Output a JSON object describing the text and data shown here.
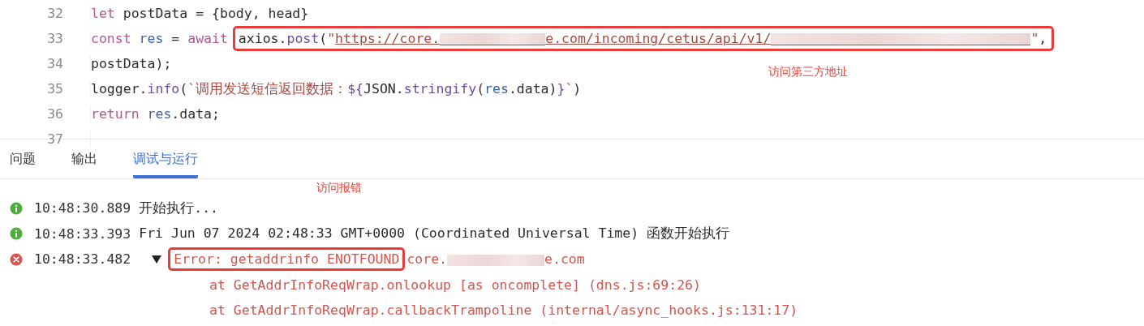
{
  "editor": {
    "lines": [
      {
        "number": "32",
        "tokens": [
          {
            "t": "let",
            "kind": "keyword"
          },
          {
            "t": " postData = {body, head}",
            "kind": "plain"
          }
        ]
      },
      {
        "number": "33",
        "tokens": [
          {
            "t": "const ",
            "kind": "keyword"
          },
          {
            "t": "res",
            "kind": "variable"
          },
          {
            "t": " = ",
            "kind": "plain"
          },
          {
            "t": "await ",
            "kind": "keyword"
          },
          {
            "kind": "box",
            "tokens": [
              {
                "t": "axios.",
                "kind": "plain"
              },
              {
                "t": "post",
                "kind": "method"
              },
              {
                "t": "(",
                "kind": "plain"
              },
              {
                "t": "\"",
                "kind": "string"
              },
              {
                "t": "https://core.",
                "kind": "link"
              },
              {
                "kind": "redacted-link"
              },
              {
                "t": "e.com/incoming/cetus/api/v1/",
                "kind": "link"
              },
              {
                "kind": "redacted-link"
              },
              {
                "t": "\"",
                "kind": "string"
              },
              {
                "t": ",",
                "kind": "plain"
              }
            ]
          }
        ]
      },
      {
        "number": "34",
        "tokens": [
          {
            "t": "postData);",
            "kind": "plain"
          }
        ]
      },
      {
        "number": "35",
        "tokens": [
          {
            "t": "logger.",
            "kind": "plain"
          },
          {
            "t": "info",
            "kind": "method"
          },
          {
            "t": "(",
            "kind": "plain"
          },
          {
            "t": "`调用发送短信返回数据：",
            "kind": "string"
          },
          {
            "t": "${",
            "kind": "method"
          },
          {
            "t": "JSON.",
            "kind": "plain"
          },
          {
            "t": "stringify",
            "kind": "method"
          },
          {
            "t": "(",
            "kind": "plain"
          },
          {
            "t": "res",
            "kind": "variable"
          },
          {
            "t": ".data)",
            "kind": "plain"
          },
          {
            "t": "}",
            "kind": "method"
          },
          {
            "t": "`",
            "kind": "string"
          },
          {
            "t": ")",
            "kind": "plain"
          }
        ]
      },
      {
        "number": "36",
        "tokens": [
          {
            "t": "return ",
            "kind": "keyword"
          },
          {
            "t": "res",
            "kind": "variable"
          },
          {
            "t": ".data;",
            "kind": "plain"
          }
        ]
      },
      {
        "number": "37"
      }
    ],
    "annotation": "访问第三方地址"
  },
  "panel": {
    "tabs": [
      {
        "label": "问题",
        "selected": false
      },
      {
        "label": "输出",
        "selected": false
      },
      {
        "label": "调试与运行",
        "selected": true
      }
    ],
    "annotation": "访问报错",
    "entries": [
      {
        "kind": "info",
        "time": "10:48:30.889",
        "expanded": false,
        "tokens": [
          {
            "t": "开始执行...",
            "kind": "plain"
          }
        ]
      },
      {
        "kind": "info",
        "time": "10:48:33.393",
        "expanded": false,
        "tokens": [
          {
            "t": "Fri Jun 07 2024 02:48:33 GMT+0000 (Coordinated Universal Time) 函数开始执行",
            "kind": "plain"
          }
        ]
      },
      {
        "kind": "error",
        "time": "10:48:33.482",
        "expanded": true,
        "tokens": [
          {
            "kind": "box",
            "tokens": [
              {
                "t": "Error: getaddrinfo ENOTFOUND",
                "kind": "error"
              }
            ]
          },
          {
            "t": "core.",
            "kind": "error"
          },
          {
            "kind": "redacted"
          },
          {
            "t": "e.com",
            "kind": "error"
          }
        ],
        "stack": [
          "at GetAddrInfoReqWrap.onlookup [as oncomplete] (dns.js:69:26)",
          "at GetAddrInfoReqWrap.callbackTrampoline (internal/async_hooks.js:131:17)"
        ]
      }
    ]
  }
}
